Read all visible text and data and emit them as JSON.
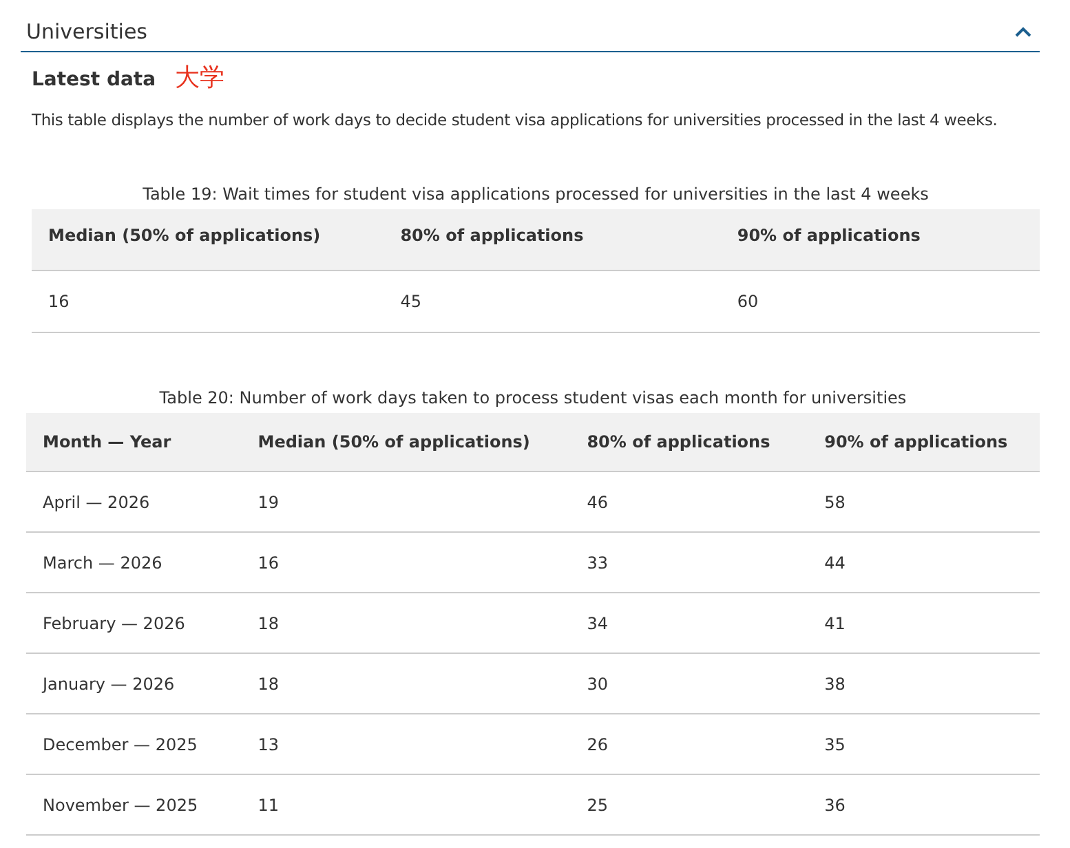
{
  "section": {
    "title": "Universities",
    "expanded": true
  },
  "subheading": "Latest data",
  "annotation": "大学",
  "description": "This table displays the number of work days to decide student visa applications for universities processed in the last 4 weeks.",
  "tables": [
    {
      "caption": "Table 19: Wait times for student visa applications processed for universities in the last 4 weeks",
      "columns": [
        "Median (50% of applications)",
        "80% of applications",
        "90% of applications"
      ],
      "rows": [
        [
          "16",
          "45",
          "60"
        ]
      ]
    },
    {
      "caption": "Table 20: Number of work days taken to process student visas each month for universities",
      "columns": [
        "Month — Year",
        "Median (50% of applications)",
        "80% of applications",
        "90% of applications"
      ],
      "rows": [
        [
          "April — 2026",
          "19",
          "46",
          "58"
        ],
        [
          "March — 2026",
          "16",
          "33",
          "44"
        ],
        [
          "February — 2026",
          "18",
          "34",
          "41"
        ],
        [
          "January — 2026",
          "18",
          "30",
          "38"
        ],
        [
          "December — 2025",
          "13",
          "26",
          "35"
        ],
        [
          "November — 2025",
          "11",
          "25",
          "36"
        ]
      ]
    }
  ]
}
